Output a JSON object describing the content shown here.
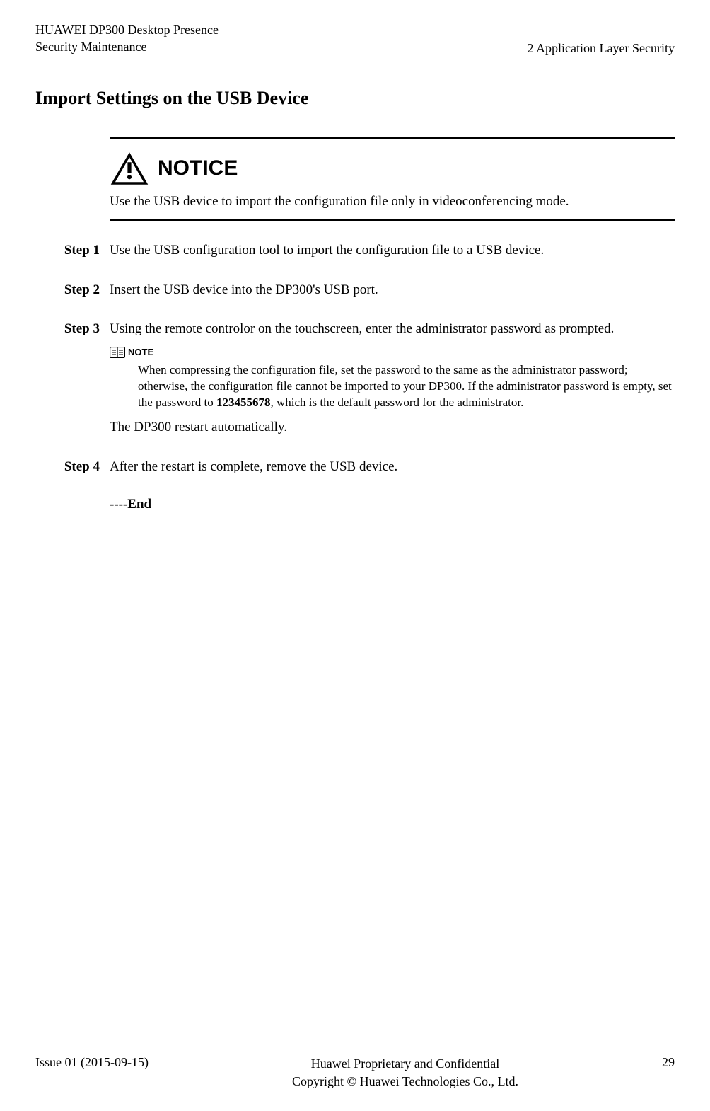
{
  "header": {
    "left_line1": "HUAWEI DP300 Desktop Presence",
    "left_line2": "Security Maintenance",
    "right": "2 Application Layer Security"
  },
  "section_title": "Import Settings on the USB Device",
  "notice": {
    "label": "NOTICE",
    "text": "Use the USB device to import the configuration file only in videoconferencing mode."
  },
  "steps": [
    {
      "label": "Step 1",
      "body": "Use the USB configuration tool to import the configuration file to a USB device."
    },
    {
      "label": "Step 2",
      "body": "Insert the USB device into the DP300's USB port."
    },
    {
      "label": "Step 3",
      "body": "Using the remote controlor on the touchscreen, enter the administrator password as prompted.",
      "note_label": "NOTE",
      "note_text_pre": "When compressing the configuration file, set the password to the same as the administrator password; otherwise, the configuration file cannot be imported to your DP300. If the administrator password is empty, set the password to ",
      "note_bold": "123455678",
      "note_text_post": ", which is the default password for the administrator.",
      "after": "The DP300 restart automatically."
    },
    {
      "label": "Step 4",
      "body": "After the restart is complete, remove the USB device."
    }
  ],
  "end_marker": "----End",
  "footer": {
    "left": "Issue 01 (2015-09-15)",
    "center_line1": "Huawei Proprietary and Confidential",
    "center_line2": "Copyright © Huawei Technologies Co., Ltd.",
    "right": "29"
  }
}
